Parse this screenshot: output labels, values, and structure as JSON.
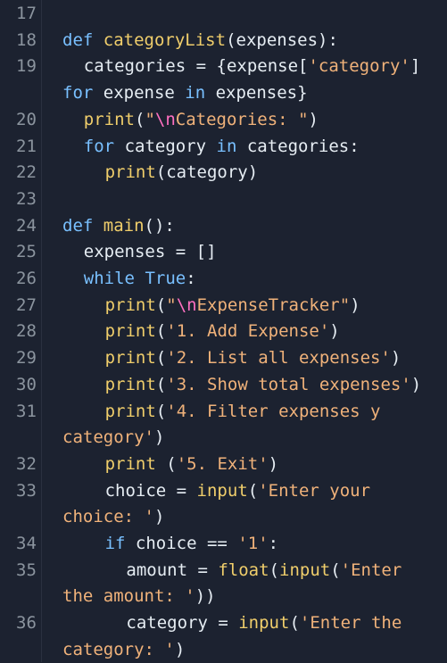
{
  "editor": {
    "lines": [
      {
        "n": "17",
        "rows": [
          {
            "indent": 0,
            "tokens": []
          }
        ]
      },
      {
        "n": "18",
        "rows": [
          {
            "indent": 0,
            "tokens": [
              {
                "t": "kw",
                "v": "def"
              },
              {
                "t": "plain",
                "v": " "
              },
              {
                "t": "fn",
                "v": "categoryList"
              },
              {
                "t": "plain",
                "v": "(expenses):"
              }
            ]
          }
        ]
      },
      {
        "n": "19",
        "rows": [
          {
            "indent": 1,
            "tokens": [
              {
                "t": "plain",
                "v": "categories = {expense["
              },
              {
                "t": "str",
                "v": "'category'"
              },
              {
                "t": "plain",
                "v": "]"
              }
            ]
          },
          {
            "indent": 0,
            "tokens": [
              {
                "t": "kw",
                "v": "for"
              },
              {
                "t": "plain",
                "v": " expense "
              },
              {
                "t": "kw",
                "v": "in"
              },
              {
                "t": "plain",
                "v": " expenses}"
              }
            ]
          }
        ]
      },
      {
        "n": "20",
        "rows": [
          {
            "indent": 1,
            "tokens": [
              {
                "t": "fn",
                "v": "print"
              },
              {
                "t": "plain",
                "v": "("
              },
              {
                "t": "str",
                "v": "\""
              },
              {
                "t": "esc",
                "v": "\\n"
              },
              {
                "t": "str",
                "v": "Categories: \""
              },
              {
                "t": "plain",
                "v": ")"
              }
            ]
          }
        ]
      },
      {
        "n": "21",
        "rows": [
          {
            "indent": 1,
            "tokens": [
              {
                "t": "kw",
                "v": "for"
              },
              {
                "t": "plain",
                "v": " category "
              },
              {
                "t": "kw",
                "v": "in"
              },
              {
                "t": "plain",
                "v": " categories:"
              }
            ]
          }
        ]
      },
      {
        "n": "22",
        "rows": [
          {
            "indent": 2,
            "tokens": [
              {
                "t": "fn",
                "v": "print"
              },
              {
                "t": "plain",
                "v": "(category)"
              }
            ]
          }
        ]
      },
      {
        "n": "23",
        "rows": [
          {
            "indent": 0,
            "tokens": []
          }
        ]
      },
      {
        "n": "24",
        "rows": [
          {
            "indent": 0,
            "tokens": [
              {
                "t": "kw",
                "v": "def"
              },
              {
                "t": "plain",
                "v": " "
              },
              {
                "t": "fn",
                "v": "main"
              },
              {
                "t": "plain",
                "v": "():"
              }
            ]
          }
        ]
      },
      {
        "n": "25",
        "rows": [
          {
            "indent": 1,
            "tokens": [
              {
                "t": "plain",
                "v": "expenses = []"
              }
            ]
          }
        ]
      },
      {
        "n": "26",
        "rows": [
          {
            "indent": 1,
            "tokens": [
              {
                "t": "kw",
                "v": "while"
              },
              {
                "t": "plain",
                "v": " "
              },
              {
                "t": "kw",
                "v": "True"
              },
              {
                "t": "plain",
                "v": ":"
              }
            ]
          }
        ]
      },
      {
        "n": "27",
        "rows": [
          {
            "indent": 2,
            "tokens": [
              {
                "t": "fn",
                "v": "print"
              },
              {
                "t": "plain",
                "v": "("
              },
              {
                "t": "str",
                "v": "\""
              },
              {
                "t": "esc",
                "v": "\\n"
              },
              {
                "t": "str",
                "v": "ExpenseTracker\""
              },
              {
                "t": "plain",
                "v": ")"
              }
            ]
          }
        ]
      },
      {
        "n": "28",
        "rows": [
          {
            "indent": 2,
            "tokens": [
              {
                "t": "fn",
                "v": "print"
              },
              {
                "t": "plain",
                "v": "("
              },
              {
                "t": "str",
                "v": "'1. Add Expense'"
              },
              {
                "t": "plain",
                "v": ")"
              }
            ]
          }
        ]
      },
      {
        "n": "29",
        "rows": [
          {
            "indent": 2,
            "tokens": [
              {
                "t": "fn",
                "v": "print"
              },
              {
                "t": "plain",
                "v": "("
              },
              {
                "t": "str",
                "v": "'2. List all expenses'"
              },
              {
                "t": "plain",
                "v": ")"
              }
            ]
          }
        ]
      },
      {
        "n": "30",
        "rows": [
          {
            "indent": 2,
            "tokens": [
              {
                "t": "fn",
                "v": "print"
              },
              {
                "t": "plain",
                "v": "("
              },
              {
                "t": "str",
                "v": "'3. Show total expenses'"
              },
              {
                "t": "plain",
                "v": ")"
              }
            ]
          }
        ]
      },
      {
        "n": "31",
        "rows": [
          {
            "indent": 2,
            "tokens": [
              {
                "t": "fn",
                "v": "print"
              },
              {
                "t": "plain",
                "v": "("
              },
              {
                "t": "str",
                "v": "'4. Filter expenses y"
              }
            ]
          },
          {
            "indent": 0,
            "tokens": [
              {
                "t": "str",
                "v": "category'"
              },
              {
                "t": "plain",
                "v": ")"
              }
            ]
          }
        ]
      },
      {
        "n": "32",
        "rows": [
          {
            "indent": 2,
            "tokens": [
              {
                "t": "fn",
                "v": "print"
              },
              {
                "t": "plain",
                "v": " ("
              },
              {
                "t": "str",
                "v": "'5. Exit'"
              },
              {
                "t": "plain",
                "v": ")"
              }
            ]
          }
        ]
      },
      {
        "n": "33",
        "rows": [
          {
            "indent": 2,
            "tokens": [
              {
                "t": "plain",
                "v": "choice = "
              },
              {
                "t": "fn",
                "v": "input"
              },
              {
                "t": "plain",
                "v": "("
              },
              {
                "t": "str",
                "v": "'Enter your"
              }
            ]
          },
          {
            "indent": 0,
            "tokens": [
              {
                "t": "str",
                "v": "choice: '"
              },
              {
                "t": "plain",
                "v": ")"
              }
            ]
          }
        ]
      },
      {
        "n": "34",
        "rows": [
          {
            "indent": 2,
            "tokens": [
              {
                "t": "kw",
                "v": "if"
              },
              {
                "t": "plain",
                "v": " choice == "
              },
              {
                "t": "str",
                "v": "'1'"
              },
              {
                "t": "plain",
                "v": ":"
              }
            ]
          }
        ]
      },
      {
        "n": "35",
        "rows": [
          {
            "indent": 3,
            "tokens": [
              {
                "t": "plain",
                "v": "amount = "
              },
              {
                "t": "fn",
                "v": "float"
              },
              {
                "t": "plain",
                "v": "("
              },
              {
                "t": "fn",
                "v": "input"
              },
              {
                "t": "plain",
                "v": "("
              },
              {
                "t": "str",
                "v": "'Enter"
              }
            ]
          },
          {
            "indent": 0,
            "tokens": [
              {
                "t": "str",
                "v": "the amount: '"
              },
              {
                "t": "plain",
                "v": "))"
              }
            ]
          }
        ]
      },
      {
        "n": "36",
        "rows": [
          {
            "indent": 3,
            "tokens": [
              {
                "t": "plain",
                "v": "category = "
              },
              {
                "t": "fn",
                "v": "input"
              },
              {
                "t": "plain",
                "v": "("
              },
              {
                "t": "str",
                "v": "'Enter the"
              }
            ]
          },
          {
            "indent": 0,
            "tokens": [
              {
                "t": "str",
                "v": "category: '"
              },
              {
                "t": "plain",
                "v": ")"
              }
            ]
          }
        ]
      }
    ]
  }
}
